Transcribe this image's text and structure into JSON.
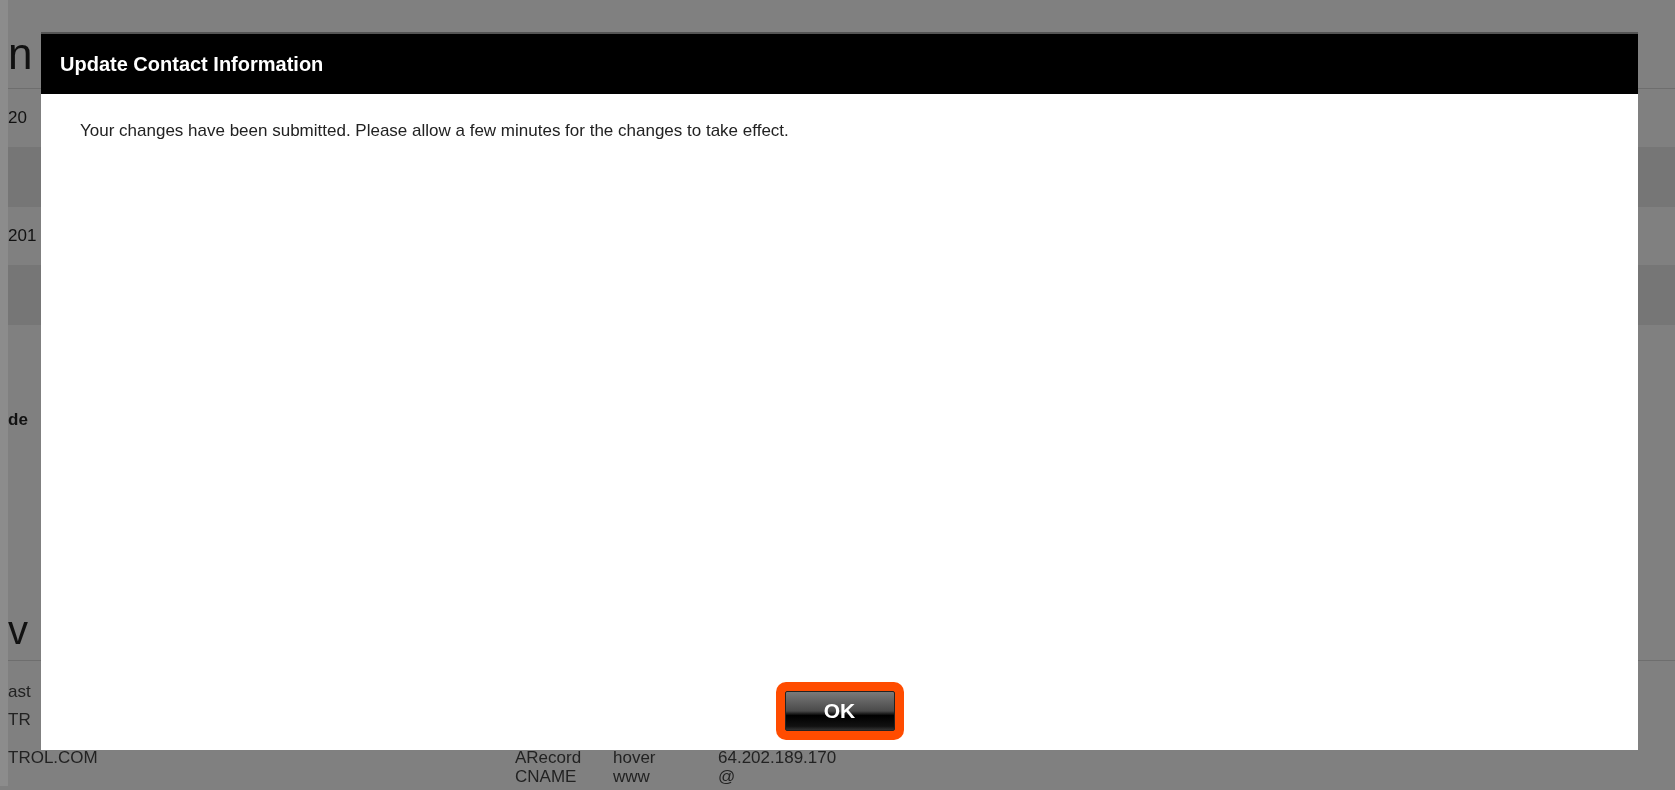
{
  "background_page": {
    "heading": "n",
    "dates": [
      "20",
      "201"
    ],
    "label": "de",
    "section_heading": "v",
    "list": [
      "ast",
      "TR",
      "TROL.COM"
    ],
    "records": [
      {
        "type": "ARecord",
        "host": "hover",
        "value": "64.202.189.170"
      },
      {
        "type": "CNAME",
        "host": "www",
        "value": "@"
      }
    ]
  },
  "dialog": {
    "title": "Update Contact Information",
    "message": "Your changes have been submitted. Please allow a few minutes for the changes to take effect.",
    "button": "OK"
  }
}
